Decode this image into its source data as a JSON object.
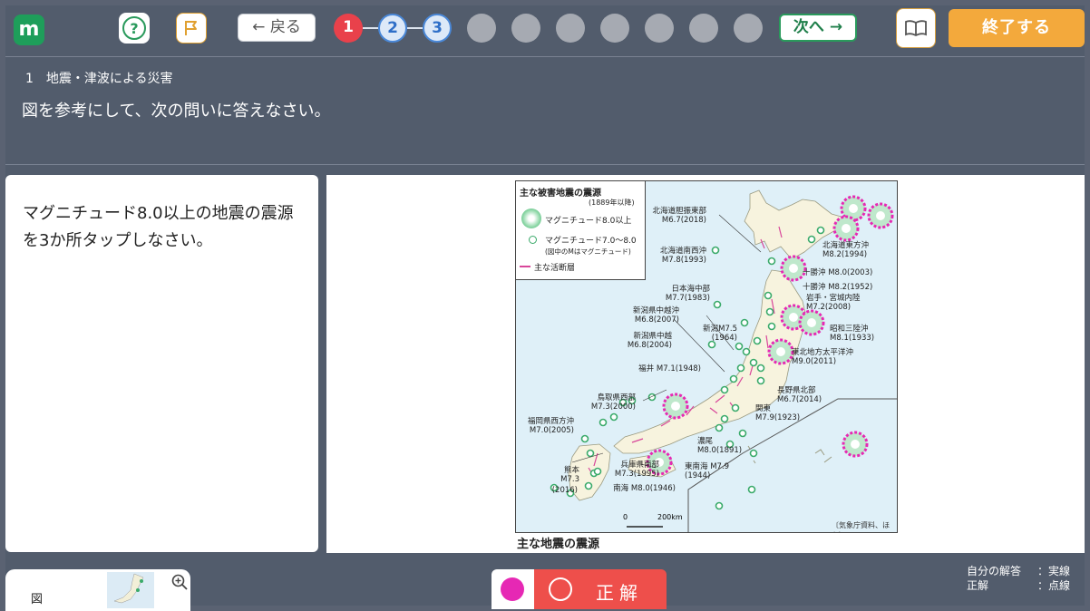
{
  "app": {
    "logo_letter": "m"
  },
  "toolbar": {
    "help_label": "?",
    "back_label": "← 戻る",
    "next_label": "次へ →",
    "end_label": "終了する"
  },
  "progress": [
    {
      "label": "1",
      "state": "current"
    },
    {
      "label": "2",
      "state": "done"
    },
    {
      "label": "3",
      "state": "done"
    },
    {
      "label": "",
      "state": "todo"
    },
    {
      "label": "",
      "state": "todo"
    },
    {
      "label": "",
      "state": "todo"
    },
    {
      "label": "",
      "state": "todo"
    },
    {
      "label": "",
      "state": "todo"
    },
    {
      "label": "",
      "state": "todo"
    },
    {
      "label": "",
      "state": "todo"
    }
  ],
  "question": {
    "label": "1　地震・津波による災害",
    "text": "図を参考にして、次の問いに答えなさい。",
    "instruction": "マグニチュード8.0以上の地震の震源を3か所タップしなさい。"
  },
  "map": {
    "legend_title": "主な被害地震の震源",
    "legend_period": "(1889年以降)",
    "legend_large": "マグニチュード8.0以上",
    "legend_small": "マグニチュード7.0～8.0",
    "legend_note": "(図中のMはマグニチュード)",
    "legend_fault": "主な活断層",
    "source": "〔気象庁資料、ほか〕",
    "scale_zero": "0",
    "scale_km": "200km",
    "caption": "主な地震の震源",
    "labels": [
      {
        "name": "北海道胆振東部",
        "mag": "M6.7(2018)"
      },
      {
        "name": "北海道南西沖",
        "mag": "M7.8(1993)"
      },
      {
        "name": "北海道東方沖",
        "mag": "M8.2(1994)"
      },
      {
        "name": "十勝沖 M8.0(2003)",
        "mag": ""
      },
      {
        "name": "十勝沖 M8.2(1952)",
        "mag": ""
      },
      {
        "name": "日本海中部",
        "mag": "M7.7(1983)"
      },
      {
        "name": "岩手・宮城内陸",
        "mag": "M7.2(2008)"
      },
      {
        "name": "新潟県中越沖",
        "mag": "M6.8(2007)"
      },
      {
        "name": "昭和三陸沖",
        "mag": "M8.1(1933)"
      },
      {
        "name": "新潟M7.5",
        "mag": "(1964)"
      },
      {
        "name": "新潟県中越",
        "mag": "M6.8(2004)"
      },
      {
        "name": "東北地方太平洋沖",
        "mag": "M9.0(2011)"
      },
      {
        "name": "福井 M7.1(1948)",
        "mag": ""
      },
      {
        "name": "長野県北部",
        "mag": "M6.7(2014)"
      },
      {
        "name": "鳥取県西部",
        "mag": "M7.3(2000)"
      },
      {
        "name": "関東",
        "mag": "M7.9(1923)"
      },
      {
        "name": "福岡県西方沖",
        "mag": "M7.0(2005)"
      },
      {
        "name": "濃尾",
        "mag": "M8.0(1891)"
      },
      {
        "name": "熊本",
        "mag": "M7.3"
      },
      {
        "name": "(2016)",
        "mag": ""
      },
      {
        "name": "兵庫県南部",
        "mag": "M7.3(1995)"
      },
      {
        "name": "東南海 M7.9",
        "mag": "(1944)"
      },
      {
        "name": "南海 M8.0(1946)",
        "mag": ""
      }
    ]
  },
  "bottom": {
    "thumb_label": "図",
    "correct_label": "正解",
    "key_mine": "自分の解答",
    "key_mine_val": "：実線",
    "key_correct": "正解",
    "key_correct_val": "：点線"
  },
  "colors": {
    "accent_green": "#2a9a5c",
    "current_red": "#e9414b",
    "end_orange": "#f3a93c",
    "marker_pink": "#e628b4"
  }
}
